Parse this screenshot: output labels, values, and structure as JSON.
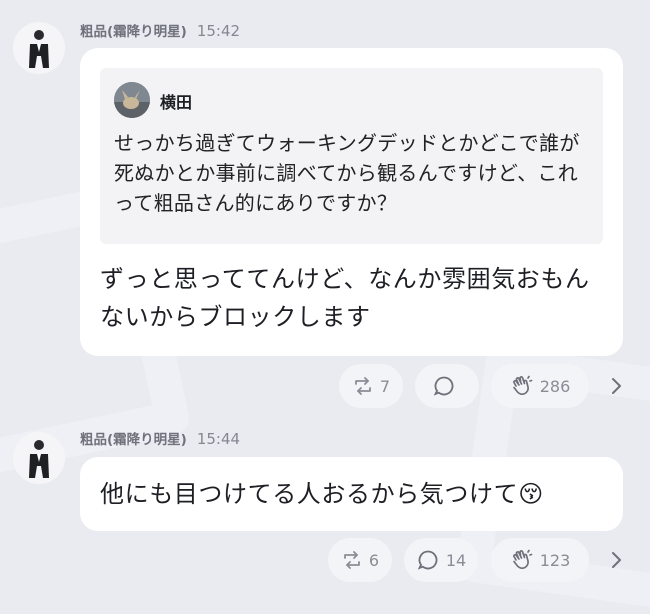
{
  "messages": [
    {
      "author": "粗品(霜降り明星)",
      "time": "15:42",
      "quote": {
        "author": "横田",
        "text": "せっかち過ぎてウォーキングデッドとかどこで誰が死ぬかとか事前に調べてから観るんですけど、これって粗品さん的にありですか？"
      },
      "text": "ずっと思っててんけど、なんか雰囲気おもんないからブロックします",
      "reactions": {
        "repost": "7",
        "comment": "",
        "clap": "286"
      }
    },
    {
      "author": "粗品(霜降り明星)",
      "time": "15:44",
      "text": "他にも目つけてる人おるから気つけて",
      "emoji": "😚",
      "reactions": {
        "repost": "6",
        "comment": "14",
        "clap": "123"
      }
    }
  ],
  "icons": {
    "repost": "repost-icon",
    "comment": "comment-icon",
    "clap": "clap-icon",
    "more": "chevron-right-icon"
  },
  "colors": {
    "background": "#e9ebf1",
    "bubble": "#ffffff",
    "quote_bg": "#f3f3f5",
    "meta_text": "#7a7d86",
    "icon": "#8a8d96"
  }
}
